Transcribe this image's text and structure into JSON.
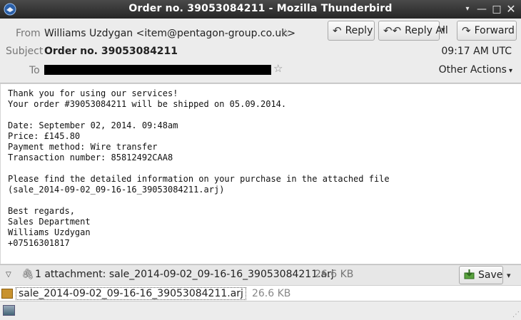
{
  "window": {
    "title": "Order no. 39053084211 - Mozilla Thunderbird",
    "controls": {
      "menu": "▾",
      "minimize": "—",
      "maximize": "□",
      "close": "✕"
    }
  },
  "header": {
    "from_label": "From",
    "from_value": "Williams Uzdygan <item@pentagon-group.co.uk>",
    "subject_label": "Subject",
    "subject_value": "Order no. 39053084211",
    "to_label": "To",
    "time": "09:17 AM UTC",
    "star_icon": "☆",
    "buttons": {
      "reply": "Reply",
      "reply_all": "Reply All",
      "forward": "Forward",
      "other_actions": "Other Actions"
    },
    "icons": {
      "reply": "↶",
      "reply_all": "↶↶",
      "forward": "↷",
      "dropdown": "▾"
    }
  },
  "body": {
    "lines": [
      "Thank you for using our services!",
      "Your order #39053084211 will be shipped on 05.09.2014.",
      "",
      "Date: September 02, 2014. 09:48am",
      "Price: £145.80",
      "Payment method: Wire transfer",
      "Transaction number: 85812492CAA8",
      "",
      "Please find the detailed information on your purchase in the attached file",
      "(sale_2014-09-02_09-16-16_39053084211.arj)",
      "",
      "Best regards,",
      "Sales Department",
      "Williams Uzdygan",
      "+07516301817"
    ]
  },
  "attachments": {
    "summary": "1 attachment: sale_2014-09-02_09-16-16_39053084211.arj",
    "total_size": "26.6 KB",
    "save_label": "Save",
    "toggle_icon": "▽",
    "clip_icon": "🖇",
    "items": [
      {
        "name": "sale_2014-09-02_09-16-16_39053084211.arj",
        "size": "26.6 KB"
      }
    ]
  },
  "statusbar": {
    "grip": "⋰"
  }
}
